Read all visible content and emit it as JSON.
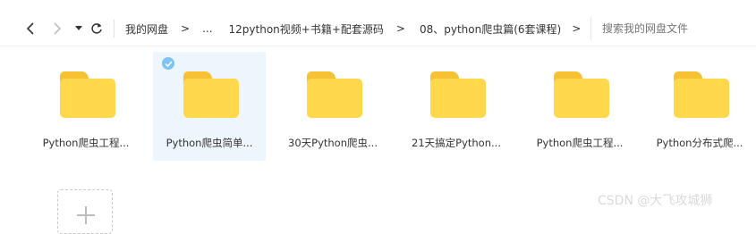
{
  "toolbar": {
    "back_icon": "chevron-left-icon",
    "forward_icon": "chevron-right-icon",
    "history_icon": "caret-down-icon",
    "refresh_icon": "refresh-icon"
  },
  "breadcrumb": {
    "items": [
      {
        "label": "我的网盘"
      },
      {
        "label": "..."
      },
      {
        "label": "12python视频+书籍+配套源码"
      },
      {
        "label": "08、python爬虫篇(6套课程)"
      }
    ],
    "separator": ">"
  },
  "search": {
    "placeholder": "搜索我的网盘文件",
    "value": ""
  },
  "folders": [
    {
      "name": "Python爬虫工程...",
      "selected": false
    },
    {
      "name": "Python爬虫简单...",
      "selected": true
    },
    {
      "name": "30天Python爬虫...",
      "selected": false
    },
    {
      "name": "21天搞定Python...",
      "selected": false
    },
    {
      "name": "Python爬虫工程...",
      "selected": false
    },
    {
      "name": "Python分布式爬...",
      "selected": false
    }
  ],
  "watermark": "CSDN @大飞攻城狮",
  "colors": {
    "folder": "#ffd84b",
    "folder_tab": "#f6c233",
    "selected_bg": "#eef6fd",
    "check": "#7fc3f2"
  }
}
